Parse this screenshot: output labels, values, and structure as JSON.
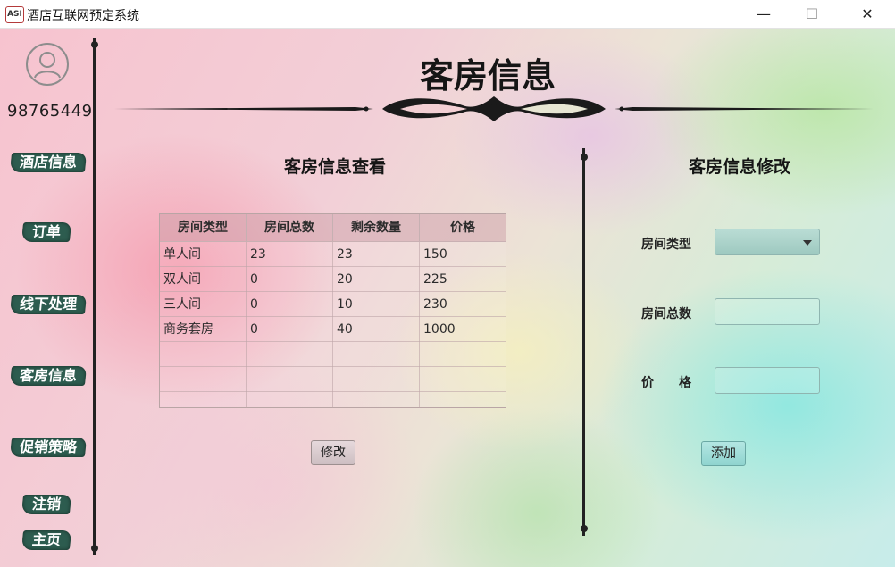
{
  "window": {
    "app_icon_text": "ASI",
    "title": "酒店互联网预定系统",
    "minimize_glyph": "—",
    "maximize_glyph": "☐",
    "close_glyph": "✕"
  },
  "user": {
    "id": "98765449",
    "avatar_icon": "user-avatar-icon"
  },
  "sidebar": {
    "items": [
      {
        "label": "酒店信息"
      },
      {
        "label": "订单"
      },
      {
        "label": "线下处理"
      },
      {
        "label": "客房信息"
      },
      {
        "label": "促销策略"
      },
      {
        "label": "注销"
      },
      {
        "label": "主页"
      }
    ]
  },
  "page": {
    "title": "客房信息"
  },
  "view_panel": {
    "title": "客房信息查看",
    "columns": [
      "房间类型",
      "房间总数",
      "剩余数量",
      "价格"
    ],
    "rows": [
      [
        "单人间",
        "23",
        "23",
        "150"
      ],
      [
        "双人间",
        "0",
        "20",
        "225"
      ],
      [
        "三人间",
        "0",
        "10",
        "230"
      ],
      [
        "商务套房",
        "0",
        "40",
        "1000"
      ]
    ],
    "modify_button": "修改"
  },
  "edit_panel": {
    "title": "客房信息修改",
    "room_type_label": "房间类型",
    "room_total_label": "房间总数",
    "price_label": "价　　格",
    "room_type_value": "",
    "room_total_value": "",
    "price_value": "",
    "add_button": "添加"
  },
  "colors": {
    "nav_button_bg": "#2d5c4f",
    "accent_teal": "#8fd4cf"
  }
}
